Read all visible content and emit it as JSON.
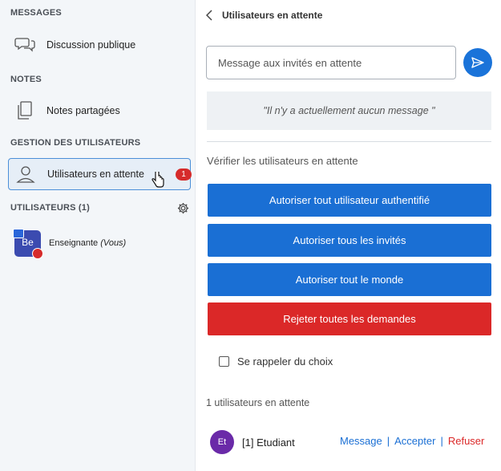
{
  "sidebar": {
    "messages_title": "MESSAGES",
    "public_chat": "Discussion publique",
    "notes_title": "NOTES",
    "shared_notes": "Notes partagées",
    "user_mgmt_title": "GESTION DES UTILISATEURS",
    "waiting_users": "Utilisateurs en attente",
    "waiting_badge": "1",
    "users_title": "UTILISATEURS (1)",
    "user": {
      "initials": "Be",
      "name": "Enseignante",
      "you": "(Vous)"
    }
  },
  "main": {
    "back_title": "Utilisateurs en attente",
    "message_placeholder": "Message aux invités en attente",
    "empty_message": "\"Il n'y a actuellement aucun message \"",
    "verify_title": "Vérifier les utilisateurs en attente",
    "buttons": {
      "allow_authenticated": "Autoriser tout utilisateur authentifié",
      "allow_guests": "Autoriser tous les invités",
      "allow_everyone": "Autoriser tout le monde",
      "reject_all": "Rejeter toutes les demandes"
    },
    "remember_choice": "Se rappeler du choix",
    "waiting_count": "1 utilisateurs en attente",
    "waiting_user": {
      "initials": "Et",
      "name": "[1] Etudiant",
      "message": "Message",
      "sep": "|",
      "accept": "Accepter",
      "refuse": "Refuser"
    }
  },
  "colors": {
    "primary": "#1a6fd4",
    "danger": "#db2828",
    "avatar_purple": "#6a2aa8",
    "avatar_blue": "#3b4bb0"
  }
}
